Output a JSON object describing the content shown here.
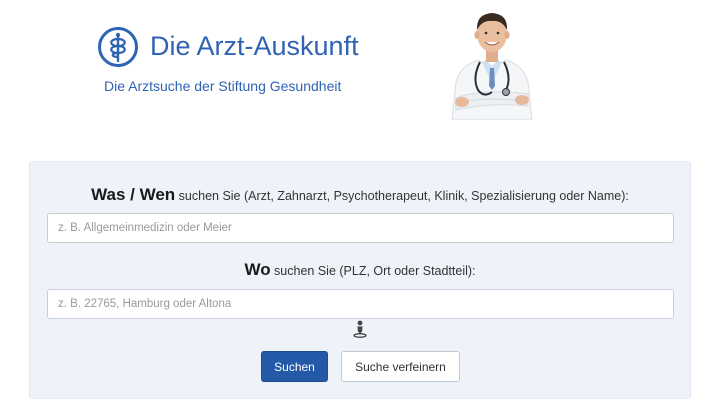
{
  "header": {
    "title": "Die Arzt-Auskunft",
    "subtitle": "Die Arztsuche der Stiftung Gesundheit",
    "logo_icon": "caduceus-logo-icon",
    "photo": "doctor-photo",
    "brand_color": "#2f63b4"
  },
  "search": {
    "what": {
      "label_strong": "Was / Wen",
      "label_rest": " suchen Sie (Arzt, Zahnarzt, Psychotherapeut, Klinik, Spezialisierung oder Name):",
      "placeholder": "z. B. Allgemeinmedizin oder Meier",
      "value": ""
    },
    "where": {
      "label_strong": "Wo",
      "label_rest": " suchen Sie (PLZ, Ort oder Stadtteil):",
      "placeholder": "z. B. 22765, Hamburg oder Altona",
      "value": ""
    },
    "location_icon": "locate-person-icon",
    "submit_label": "Suchen",
    "refine_label": "Suche verfeinern",
    "primary_color": "#2459a8",
    "panel_color": "#eef3fa"
  }
}
